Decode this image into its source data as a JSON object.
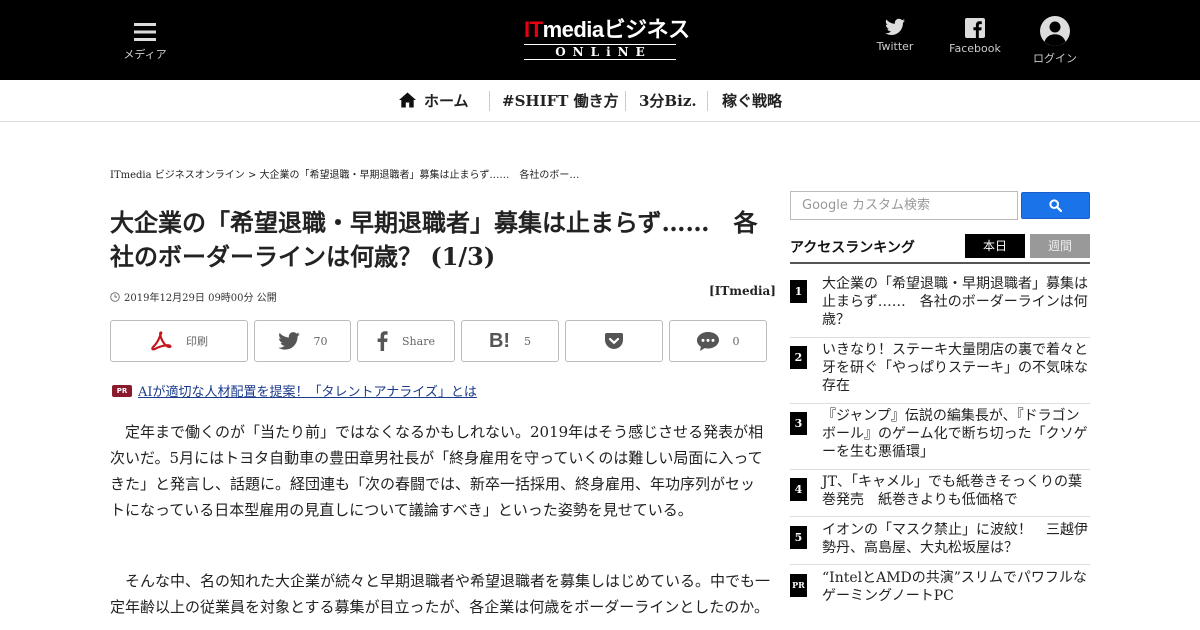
{
  "header": {
    "menu_label": "メディア",
    "logo": {
      "brand_red": "IT",
      "brand_white": "mediaビジネス",
      "tagline": "ONLiNE"
    },
    "twitter_label": "Twitter",
    "facebook_label": "Facebook",
    "login_label": "ログイン"
  },
  "nav": {
    "home": "ホーム",
    "items": [
      "#SHIFT 働き方",
      "3分Biz.",
      "稼ぐ戦略"
    ]
  },
  "breadcrumb": {
    "root": "ITmedia ビジネスオンライン",
    "separator": ">",
    "current": "大企業の「希望退職・早期退職者」募集は止まらず……　各社のボー…"
  },
  "article": {
    "title": "大企業の「希望退職・早期退職者」募集は止まらず……　各社のボーダーラインは何歳？ (1/3)",
    "date": "2019年12月29日 09時00分 公開",
    "source": "[ITmedia]",
    "pr_tag": "PR",
    "pr_link": "AIが適切な人材配置を提案！「タレントアナライズ」とは",
    "paragraphs": [
      "定年まで働くのが「当たり前」ではなくなるかもしれない。2019年はそう感じさせる発表が相次いだ。5月にはトヨタ自動車の豊田章男社長が「終身雇用を守っていくのは難しい局面に入ってきた」と発言し、話題に。経団連も「次の春闘では、新卒一括採用、終身雇用、年功序列がセットになっている日本型雇用の見直しについて議論すべき」といった姿勢を見せている。",
      "そんな中、名の知れた大企業が続々と早期退職者や希望退職者を募集しはじめている。中でも一定年齢以上の従業員を対象とする募集が目立ったが、各企業は何歳をボーダーラインとしたのか。"
    ]
  },
  "share": {
    "print_label": "印刷",
    "twitter_count": "70",
    "facebook_label": "Share",
    "hatena_count": "5",
    "comment_count": "0"
  },
  "sidebar": {
    "search_placeholder": "Google カスタム検索",
    "ranking_title": "アクセスランキング",
    "tab_today": "本日",
    "tab_week": "週間",
    "ranking": [
      {
        "num": "1",
        "text": "大企業の「希望退職・早期退職者」募集は止まらず……　各社のボーダーラインは何歳？"
      },
      {
        "num": "2",
        "text": "いきなり！ステーキ大量閉店の裏で着々と牙を研ぐ「やっぱりステーキ」の不気味な存在"
      },
      {
        "num": "3",
        "text": "『ジャンプ』伝説の編集長が、『ドラゴンボール』のゲーム化で断ち切った「クソゲーを生む悪循環」"
      },
      {
        "num": "4",
        "text": "JT、「キャメル」でも紙巻きそっくりの葉巻発売　紙巻きよりも低価格で"
      },
      {
        "num": "5",
        "text": "イオンの「マスク禁止」に波紋！　三越伊勢丹、高島屋、大丸松坂屋は？"
      },
      {
        "num": "PR",
        "text": "“IntelとAMDの共演”スリムでパワフルなゲーミングノートPC"
      }
    ]
  },
  "colors": {
    "header_bg": "#000000",
    "logo_red": "#e60012",
    "search_button": "#1a73e8",
    "pr_tag": "#8a1b2e",
    "link": "#1a3a8c"
  }
}
